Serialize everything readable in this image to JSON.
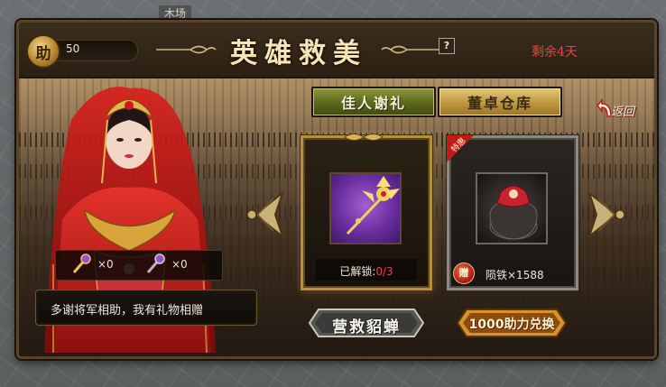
{
  "map": {
    "tag": "木场"
  },
  "header": {
    "help_badge": "助",
    "help_count": "50",
    "title": "英雄救美",
    "help_icon": "?",
    "days_left": "剩余4天"
  },
  "tabs": [
    {
      "label": "佳人谢礼",
      "active": true
    },
    {
      "label": "董卓仓库",
      "active": false
    }
  ],
  "back_label": "返回",
  "heroine": {
    "item_counts": [
      {
        "icon": "gold-scepter-icon",
        "count": "×0"
      },
      {
        "icon": "silver-scepter-icon",
        "count": "×0"
      }
    ],
    "dialog": "多谢将军相助，我有礼物相赠"
  },
  "cards": [
    {
      "item_icon": "golden-hairpin-icon",
      "unlock_label": "已解锁:",
      "unlock_progress": "0/3"
    },
    {
      "item_icon": "red-jar-icon",
      "ribbon": "特惠",
      "gift_badge": "赠",
      "gift_text": "陨铁×1588"
    }
  ],
  "buttons": {
    "rescue": "营救貂蝉",
    "exchange": "1000助力兑换"
  },
  "colors": {
    "accent_red": "#e5473c",
    "title_gold": "#f7e5b6",
    "tab_active_green": "#6a7524",
    "tab_inactive_gold": "#c29a44"
  }
}
